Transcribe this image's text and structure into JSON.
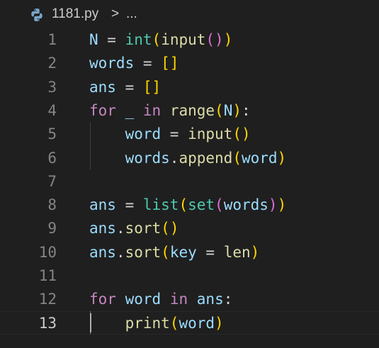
{
  "breadcrumb": {
    "file_icon": "python-file-icon",
    "file_name": "1181.py",
    "separator": ">",
    "more": "..."
  },
  "editor": {
    "active_line": 13,
    "lines": [
      {
        "number": "1",
        "tokens": [
          {
            "t": "N",
            "c": "var"
          },
          {
            "t": " = ",
            "c": "op"
          },
          {
            "t": "int",
            "c": "type"
          },
          {
            "t": "(",
            "c": "br1"
          },
          {
            "t": "input",
            "c": "fn"
          },
          {
            "t": "()",
            "c": "br2"
          },
          {
            "t": ")",
            "c": "br1"
          }
        ]
      },
      {
        "number": "2",
        "tokens": [
          {
            "t": "words",
            "c": "var"
          },
          {
            "t": " = ",
            "c": "op"
          },
          {
            "t": "[]",
            "c": "br1"
          }
        ]
      },
      {
        "number": "3",
        "tokens": [
          {
            "t": "ans",
            "c": "var"
          },
          {
            "t": " = ",
            "c": "op"
          },
          {
            "t": "[]",
            "c": "br1"
          }
        ]
      },
      {
        "number": "4",
        "tokens": [
          {
            "t": "for",
            "c": "kw"
          },
          {
            "t": " _ ",
            "c": "var"
          },
          {
            "t": "in",
            "c": "kw"
          },
          {
            "t": " ",
            "c": "op"
          },
          {
            "t": "range",
            "c": "fn"
          },
          {
            "t": "(",
            "c": "br1"
          },
          {
            "t": "N",
            "c": "var"
          },
          {
            "t": ")",
            "c": "br1"
          },
          {
            "t": ":",
            "c": "op"
          }
        ]
      },
      {
        "number": "5",
        "tokens": [
          {
            "t": "    ",
            "c": "op"
          },
          {
            "t": "word",
            "c": "var"
          },
          {
            "t": " = ",
            "c": "op"
          },
          {
            "t": "input",
            "c": "fn"
          },
          {
            "t": "()",
            "c": "br1"
          }
        ]
      },
      {
        "number": "6",
        "tokens": [
          {
            "t": "    ",
            "c": "op"
          },
          {
            "t": "words",
            "c": "var"
          },
          {
            "t": ".",
            "c": "op"
          },
          {
            "t": "append",
            "c": "fn"
          },
          {
            "t": "(",
            "c": "br1"
          },
          {
            "t": "word",
            "c": "var"
          },
          {
            "t": ")",
            "c": "br1"
          }
        ]
      },
      {
        "number": "7",
        "tokens": []
      },
      {
        "number": "8",
        "tokens": [
          {
            "t": "ans",
            "c": "var"
          },
          {
            "t": " = ",
            "c": "op"
          },
          {
            "t": "list",
            "c": "type"
          },
          {
            "t": "(",
            "c": "br1"
          },
          {
            "t": "set",
            "c": "type"
          },
          {
            "t": "(",
            "c": "br2"
          },
          {
            "t": "words",
            "c": "var"
          },
          {
            "t": ")",
            "c": "br2"
          },
          {
            "t": ")",
            "c": "br1"
          }
        ]
      },
      {
        "number": "9",
        "tokens": [
          {
            "t": "ans",
            "c": "var"
          },
          {
            "t": ".",
            "c": "op"
          },
          {
            "t": "sort",
            "c": "fn"
          },
          {
            "t": "()",
            "c": "br1"
          }
        ]
      },
      {
        "number": "10",
        "tokens": [
          {
            "t": "ans",
            "c": "var"
          },
          {
            "t": ".",
            "c": "op"
          },
          {
            "t": "sort",
            "c": "fn"
          },
          {
            "t": "(",
            "c": "br1"
          },
          {
            "t": "key",
            "c": "var"
          },
          {
            "t": " = ",
            "c": "op"
          },
          {
            "t": "len",
            "c": "fn"
          },
          {
            "t": ")",
            "c": "br1"
          }
        ]
      },
      {
        "number": "11",
        "tokens": []
      },
      {
        "number": "12",
        "tokens": [
          {
            "t": "for",
            "c": "kw"
          },
          {
            "t": " ",
            "c": "op"
          },
          {
            "t": "word",
            "c": "var"
          },
          {
            "t": " ",
            "c": "op"
          },
          {
            "t": "in",
            "c": "kw"
          },
          {
            "t": " ",
            "c": "op"
          },
          {
            "t": "ans",
            "c": "var"
          },
          {
            "t": ":",
            "c": "op"
          }
        ]
      },
      {
        "number": "13",
        "tokens": [
          {
            "t": "    ",
            "c": "op"
          },
          {
            "t": "print",
            "c": "fn"
          },
          {
            "t": "(",
            "c": "br1"
          },
          {
            "t": "word",
            "c": "var"
          },
          {
            "t": ")",
            "c": "br1"
          }
        ]
      }
    ]
  }
}
